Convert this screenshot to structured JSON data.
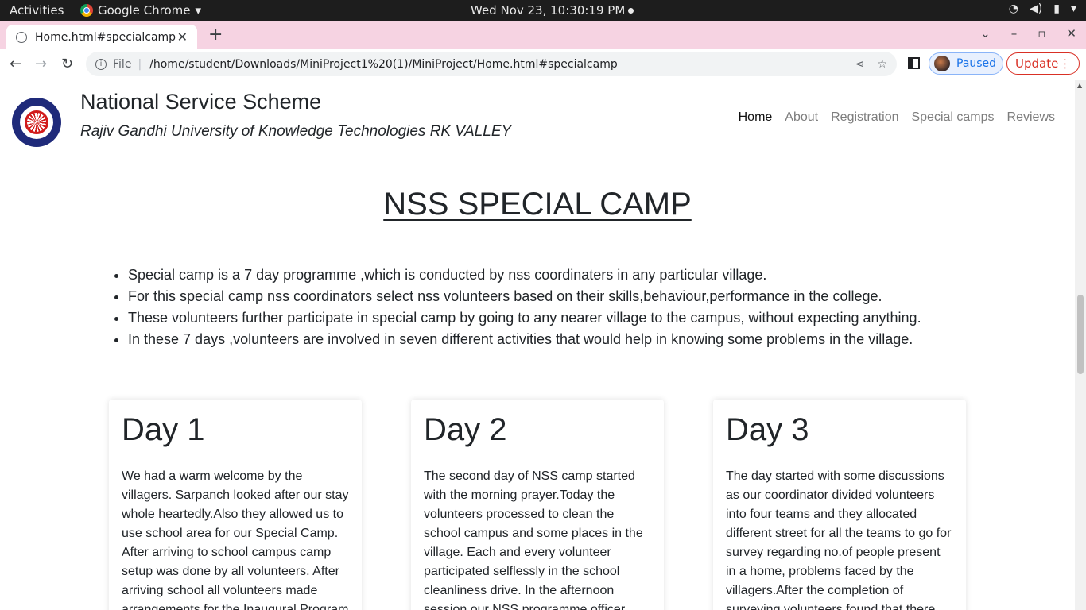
{
  "system": {
    "activities": "Activities",
    "app_name": "Google Chrome",
    "clock": "Wed Nov 23, 10:30:19 PM"
  },
  "browser": {
    "tab_title": "Home.html#specialcamp",
    "omnibox_file": "File",
    "url": "/home/student/Downloads/MiniProject1%20(1)/MiniProject/Home.html#specialcamp",
    "profile_status": "Paused",
    "update_label": "Update"
  },
  "site": {
    "title": "National Service Scheme",
    "subtitle": "Rajiv Gandhi University of Knowledge Technologies RK VALLEY",
    "nav": {
      "home": "Home",
      "about": "About",
      "registration": "Registration",
      "special_camps": "Special camps",
      "reviews": "Reviews"
    }
  },
  "section": {
    "heading": "NSS SPECIAL CAMP",
    "bullets": [
      "Special camp is a 7 day programme ,which is conducted by nss coordinaters in any particular village.",
      "For this special camp nss coordinators select nss volunteers based on their skills,behaviour,performance in the college.",
      "These volunteers further participate in special camp by going to any nearer village to the campus, without expecting anything.",
      "In these 7 days ,volunteers are involved in seven different activities that would help in knowing some problems in the village."
    ],
    "cards": [
      {
        "title": "Day 1",
        "text": "We had a warm welcome by the villagers. Sarpanch looked after our stay whole heartedly.Also they allowed us to use school area for our Special Camp. After arriving to school campus camp setup was done by all volunteers. After arriving school all volunteers made arrangements for the Inaugural Program"
      },
      {
        "title": "Day 2",
        "text": "The second day of NSS camp started with the morning prayer.Today the volunteers processed to clean the school campus and some places in the village. Each and every volunteer participated selflessly in the school cleanliness drive. In the afternoon session our NSS programme officer"
      },
      {
        "title": "Day 3",
        "text": "The day started with some discussions as our coordinator divided volunteers into four teams and they allocated different street for all the teams to go for survey regarding no.of people present in a home, problems faced by the villagers.After the completion of surveying volunteers found that there"
      }
    ]
  }
}
